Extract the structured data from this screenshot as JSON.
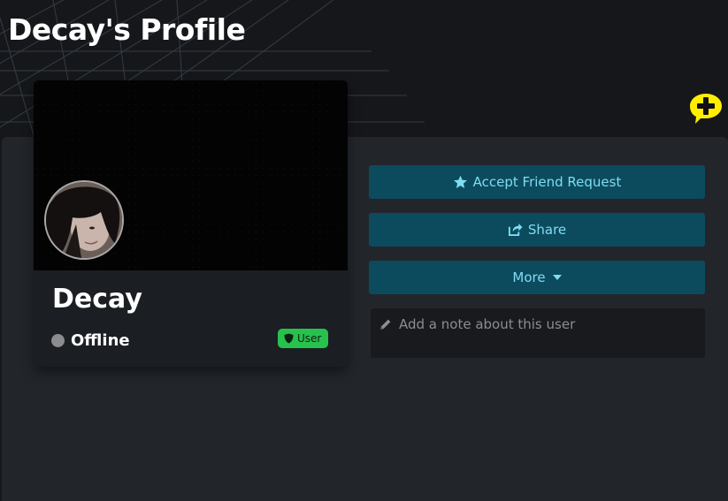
{
  "page": {
    "title": "Decay's Profile"
  },
  "profile": {
    "username": "Decay",
    "status": "Offline",
    "role_badge": "User"
  },
  "actions": {
    "accept_friend_request": "Accept Friend Request",
    "share": "Share",
    "more": "More"
  },
  "note": {
    "placeholder": "Add a note about this user",
    "value": ""
  },
  "icons": {
    "chat": "chat-plus-icon",
    "accept": "star-icon",
    "share": "share-icon",
    "more": "caret-down-icon",
    "note": "pencil-icon",
    "badge": "shield-icon",
    "status": "status-dot-icon"
  },
  "colors": {
    "button_bg": "#0c4b5e",
    "button_text": "#7fdcf1",
    "badge_bg": "#26c24d",
    "status_offline": "#8a8c8f",
    "chat_bubble": "#ffee00"
  }
}
